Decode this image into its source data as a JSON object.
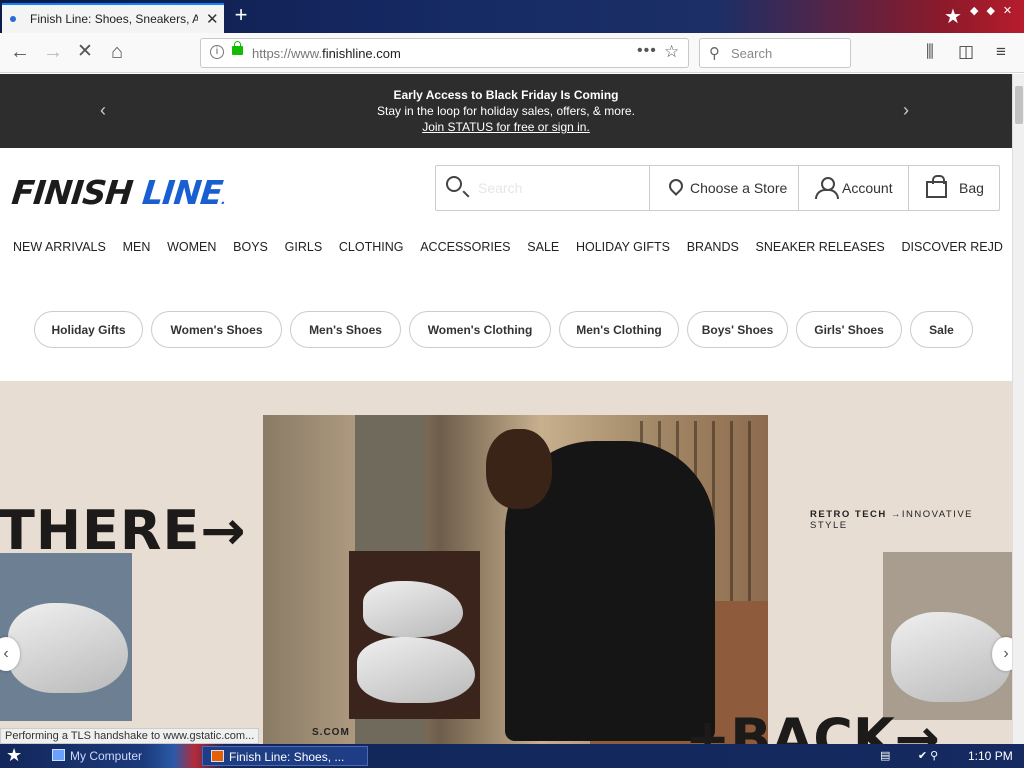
{
  "browser": {
    "tab_title": "Finish Line: Shoes, Sneakers, Athl",
    "tab_close": "✕",
    "new_tab": "+",
    "url_prefix": "https://www.",
    "url_domain": "finishline.com",
    "search_placeholder": "Search",
    "page_actions": "•••",
    "icons": [
      "back-arrow-icon",
      "forward-arrow-icon",
      "stop-icon",
      "home-icon",
      "info-icon",
      "lock-icon",
      "bookmark-star-icon",
      "library-icon",
      "sidebar-icon",
      "menu-icon"
    ]
  },
  "promo": {
    "line1": "Early Access to Black Friday Is Coming",
    "line2": "Stay in the loop for holiday sales, offers, & more.",
    "line3": "Join STATUS for free or sign in.",
    "prev": "‹",
    "next": "›"
  },
  "logo": {
    "part1": "FINISH ",
    "part2": "LINE",
    "mark": "."
  },
  "site_header": {
    "search_placeholder": "Search",
    "store_label": "Choose a Store",
    "account_label": "Account",
    "bag_label": "Bag"
  },
  "nav": [
    "NEW ARRIVALS",
    "MEN",
    "WOMEN",
    "BOYS",
    "GIRLS",
    "CLOTHING",
    "ACCESSORIES",
    "SALE",
    "HOLIDAY GIFTS",
    "BRANDS",
    "SNEAKER RELEASES",
    "DISCOVER REJD"
  ],
  "pills": [
    "Holiday Gifts",
    "Women's Shoes",
    "Men's Shoes",
    "Women's Clothing",
    "Men's Clothing",
    "Boys' Shoes",
    "Girls' Shoes",
    "Sale"
  ],
  "hero": {
    "headline_left": "THERE→",
    "tagline_bold": "RETRO TECH",
    "tagline_rest": "→INNOVATIVE STYLE",
    "headline_bottom": "+BACK→",
    "small_url": "S.COM",
    "prev": "‹",
    "next": "›"
  },
  "status_text": "Performing a TLS handshake to www.gstatic.com...",
  "taskbar": {
    "item1": "My Computer",
    "item2": "Finish Line: Shoes, ...",
    "clock": "1:10 PM"
  }
}
